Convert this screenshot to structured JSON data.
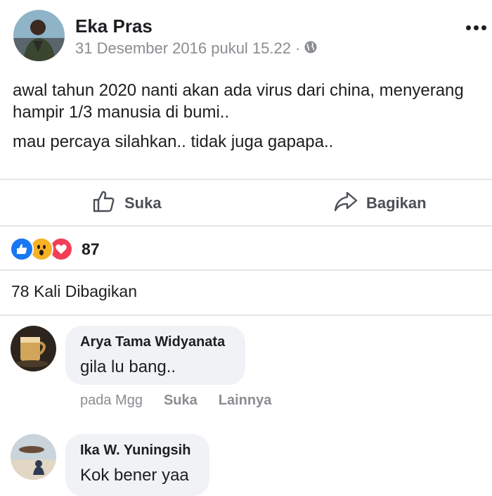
{
  "post": {
    "author": "Eka Pras",
    "timestamp": "31 Desember 2016 pukul 15.22 ·",
    "privacy_icon": "globe-icon",
    "paragraphs": [
      "awal tahun 2020 nanti akan ada virus dari china, menyerang",
      "hampir 1/3 manusia di bumi..",
      "mau percaya silahkan.. tidak juga gapapa.."
    ]
  },
  "actions": {
    "like_label": "Suka",
    "share_label": "Bagikan"
  },
  "reactions": {
    "icons": [
      "like-icon",
      "wow-icon",
      "love-icon"
    ],
    "count": "87"
  },
  "shares": {
    "text": "78 Kali Dibagikan"
  },
  "comments": [
    {
      "author": "Arya Tama Widyanata",
      "text": "gila lu bang..",
      "time": "pada Mgg",
      "like_label": "Suka",
      "more_label": "Lainnya"
    },
    {
      "author": "Ika W. Yuningsih",
      "text": "Kok bener yaa"
    }
  ],
  "colors": {
    "like_blue": "#1877f2",
    "love_red": "#f33e58",
    "wow_yellow": "#f7b125",
    "secondary_text": "#8a8d91",
    "bubble": "#f0f2f5"
  }
}
